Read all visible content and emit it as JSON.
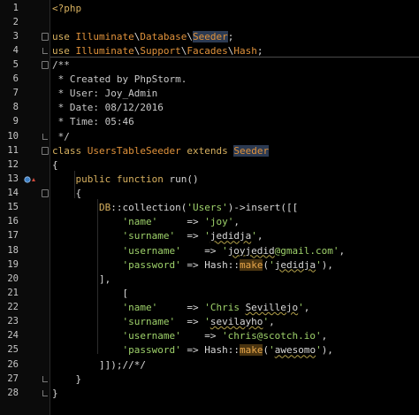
{
  "editor": {
    "lines": [
      {
        "n": "1",
        "t": [
          [
            "kw",
            "<?php"
          ]
        ]
      },
      {
        "n": "2",
        "t": []
      },
      {
        "n": "3",
        "t": [
          [
            "kw",
            "use "
          ],
          [
            "ns",
            "Illuminate"
          ],
          [
            "pl",
            "\\"
          ],
          [
            "ns",
            "Database"
          ],
          [
            "pl",
            "\\"
          ],
          [
            "hl",
            "Seeder"
          ],
          [
            "pl",
            ";"
          ]
        ]
      },
      {
        "n": "4",
        "t": [
          [
            "kw",
            "use "
          ],
          [
            "ns",
            "Illuminate"
          ],
          [
            "pl",
            "\\"
          ],
          [
            "ns",
            "Support"
          ],
          [
            "pl",
            "\\"
          ],
          [
            "ns",
            "Facades"
          ],
          [
            "pl",
            "\\"
          ],
          [
            "ns",
            "Hash"
          ],
          [
            "pl",
            ";"
          ]
        ]
      },
      {
        "n": "5",
        "t": [
          [
            "cm",
            "/**"
          ]
        ]
      },
      {
        "n": "6",
        "t": [
          [
            "cm",
            " * Created by PhpStorm."
          ]
        ]
      },
      {
        "n": "7",
        "t": [
          [
            "cm",
            " * User: Joy_Admin"
          ]
        ]
      },
      {
        "n": "8",
        "t": [
          [
            "cm",
            " * Date: 08/12/2016"
          ]
        ]
      },
      {
        "n": "9",
        "t": [
          [
            "cm",
            " * Time: 05:46"
          ]
        ]
      },
      {
        "n": "10",
        "t": [
          [
            "cm",
            " */"
          ]
        ]
      },
      {
        "n": "11",
        "t": [
          [
            "kw",
            "class "
          ],
          [
            "cls",
            "UsersTableSeeder "
          ],
          [
            "kw",
            "extends "
          ],
          [
            "hlc",
            "Seeder"
          ]
        ]
      },
      {
        "n": "12",
        "t": [
          [
            "pl",
            "{"
          ]
        ]
      },
      {
        "n": "13",
        "t": [
          [
            "kw",
            "    public function "
          ],
          [
            "fn",
            "run"
          ],
          [
            "pl",
            "()"
          ]
        ]
      },
      {
        "n": "14",
        "t": [
          [
            "pl",
            "    {"
          ]
        ]
      },
      {
        "n": "15",
        "t": [
          [
            "kw",
            "        DB"
          ],
          [
            "pl",
            "::"
          ],
          [
            "fn",
            "collection"
          ],
          [
            "pl",
            "("
          ],
          [
            "str",
            "'Users'"
          ],
          [
            "pl",
            ")->"
          ],
          [
            "fn",
            "insert"
          ],
          [
            "pl",
            "([["
          ]
        ]
      },
      {
        "n": "16",
        "t": [
          [
            "str",
            "            'name'"
          ],
          [
            "op",
            "     => "
          ],
          [
            "str",
            "'joy'"
          ],
          [
            "pl",
            ","
          ]
        ]
      },
      {
        "n": "17",
        "t": [
          [
            "str",
            "            'surname'"
          ],
          [
            "op",
            "  => "
          ],
          [
            "str",
            "'"
          ],
          [
            "sq",
            "jedidja"
          ],
          [
            "str",
            "'"
          ],
          [
            "pl",
            ","
          ]
        ]
      },
      {
        "n": "18",
        "t": [
          [
            "str",
            "            'username'"
          ],
          [
            "op",
            "    => "
          ],
          [
            "str",
            "'"
          ],
          [
            "sq",
            "joyjedid"
          ],
          [
            "str",
            "@gmail.com'"
          ],
          [
            "pl",
            ","
          ]
        ]
      },
      {
        "n": "19",
        "t": [
          [
            "str",
            "            'password'"
          ],
          [
            "op",
            " => "
          ],
          [
            "pl",
            "Hash::"
          ],
          [
            "mk",
            "make"
          ],
          [
            "pl",
            "("
          ],
          [
            "str",
            "'"
          ],
          [
            "sq",
            "jedidja"
          ],
          [
            "str",
            "'"
          ],
          [
            "pl",
            "),"
          ]
        ]
      },
      {
        "n": "20",
        "t": [
          [
            "pl",
            "        ],"
          ]
        ]
      },
      {
        "n": "21",
        "t": [
          [
            "pl",
            "            ["
          ]
        ]
      },
      {
        "n": "22",
        "t": [
          [
            "str",
            "            'name'"
          ],
          [
            "op",
            "     => "
          ],
          [
            "str",
            "'Chris "
          ],
          [
            "sq",
            "Sevillejo"
          ],
          [
            "str",
            "'"
          ],
          [
            "pl",
            ","
          ]
        ]
      },
      {
        "n": "23",
        "t": [
          [
            "str",
            "            'surname'"
          ],
          [
            "op",
            "  => "
          ],
          [
            "str",
            "'"
          ],
          [
            "sq",
            "sevilayho"
          ],
          [
            "str",
            "'"
          ],
          [
            "pl",
            ","
          ]
        ]
      },
      {
        "n": "24",
        "t": [
          [
            "str",
            "            'username'"
          ],
          [
            "op",
            "    => "
          ],
          [
            "str",
            "'chris@scotch.io'"
          ],
          [
            "pl",
            ","
          ]
        ]
      },
      {
        "n": "25",
        "t": [
          [
            "str",
            "            'password'"
          ],
          [
            "op",
            " => "
          ],
          [
            "pl",
            "Hash::"
          ],
          [
            "mk",
            "make"
          ],
          [
            "pl",
            "("
          ],
          [
            "str",
            "'"
          ],
          [
            "sq",
            "awesomo"
          ],
          [
            "str",
            "'"
          ],
          [
            "pl",
            "),"
          ]
        ]
      },
      {
        "n": "26",
        "t": [
          [
            "pl",
            "        ]]);//*/"
          ]
        ]
      },
      {
        "n": "27",
        "t": [
          [
            "pl",
            "    }"
          ]
        ]
      },
      {
        "n": "28",
        "t": [
          [
            "pl",
            "}"
          ]
        ]
      }
    ],
    "colors": {
      "background": "#000000",
      "keyword": "#d7b05f",
      "namespace": "#e0923b",
      "string": "#9ed16a",
      "comment": "#c9c9c9",
      "selection": "#2c3a52"
    },
    "icons": [
      "fold-marker-icon",
      "fold-end-icon",
      "override-method-icon"
    ]
  }
}
